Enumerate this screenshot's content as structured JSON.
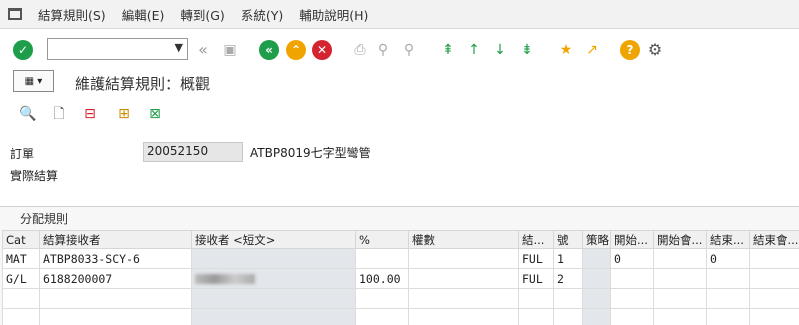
{
  "menubar": {
    "items": [
      "結算規則(S)",
      "編輯(E)",
      "轉到(G)",
      "系統(Y)",
      "輔助說明(H)"
    ]
  },
  "toolbar": {
    "command_field": {
      "value": "",
      "placeholder": ""
    }
  },
  "title_box": {
    "icon": "table-settings-icon"
  },
  "page_title": "維護結算規則：概觀",
  "order": {
    "label": "訂單",
    "value": "20052150",
    "description": "ATBP8019七字型彎管"
  },
  "actual_settlement_label": "實際結算",
  "distribution_rules": {
    "title": "分配規則",
    "headers": [
      "Cat",
      "結算接收者",
      "接收者 <短文>",
      "%",
      "權數",
      "結...",
      "號",
      "策略",
      "開始...",
      "開始會...",
      "結束...",
      "結束會..."
    ],
    "rows": [
      [
        "MAT",
        "ATBP8033-SCY-6",
        "",
        "",
        "",
        "FUL",
        "1",
        "",
        "0",
        "",
        "0",
        ""
      ],
      [
        "G/L",
        "6188200007",
        "",
        "100.00",
        "",
        "FUL",
        "2",
        "",
        "",
        "",
        "",
        ""
      ],
      [
        "",
        "",
        "",
        "",
        "",
        "",
        "",
        "",
        "",
        "",
        "",
        ""
      ],
      [
        "",
        "",
        "",
        "",
        "",
        "",
        "",
        "",
        "",
        "",
        "",
        ""
      ]
    ]
  },
  "colors": {
    "green": "#1e9e4a",
    "orange": "#f0a400",
    "red": "#d3242f",
    "menu_bg": "#f2f2f2"
  }
}
